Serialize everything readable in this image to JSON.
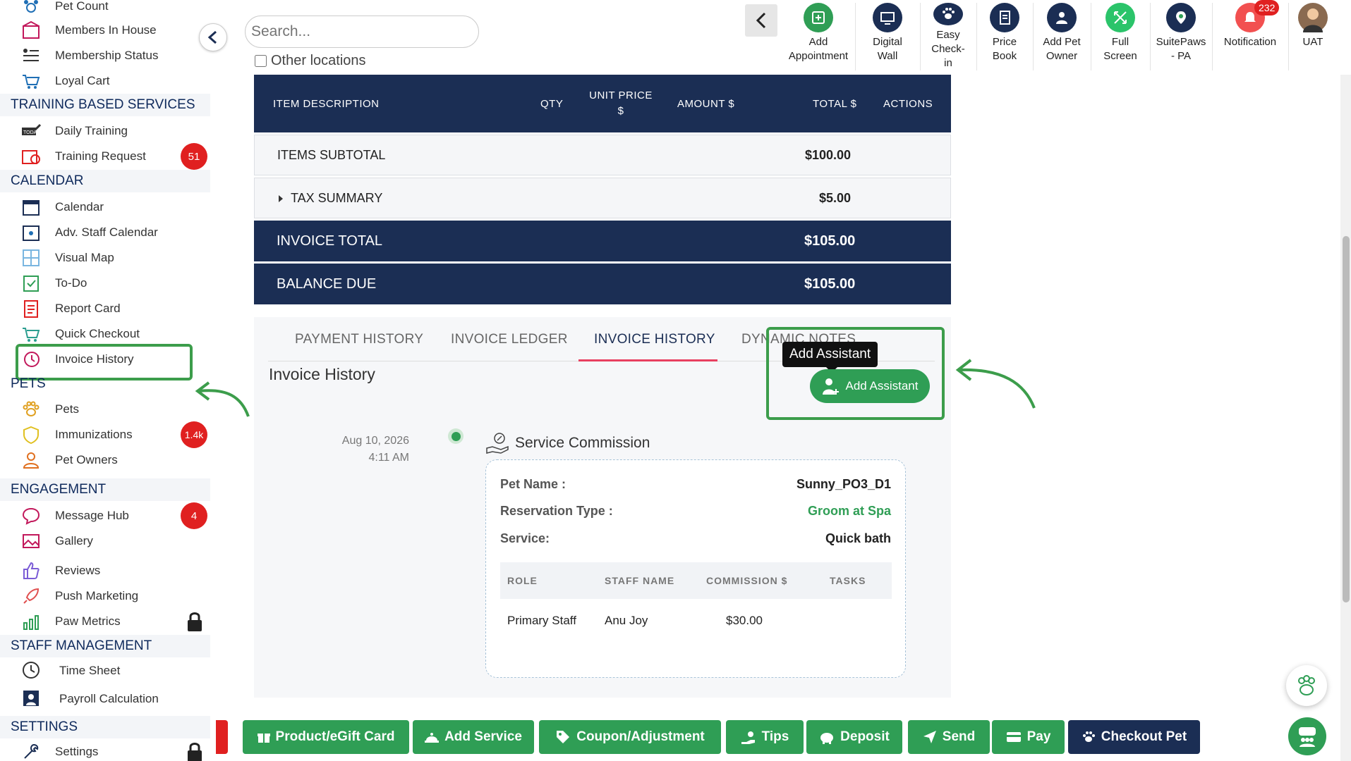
{
  "sidebar": {
    "items_top": [
      {
        "label": "Pet Count",
        "icon": "paw-count-icon"
      },
      {
        "label": "Members In House",
        "icon": "house-icon"
      },
      {
        "label": "Membership Status",
        "icon": "list-icon"
      },
      {
        "label": "Loyal Cart",
        "icon": "loyal-cart-icon"
      }
    ],
    "training_heading": "TRAINING BASED SERVICES",
    "training": [
      {
        "label": "Daily Training",
        "icon": "today-icon"
      },
      {
        "label": "Training Request",
        "icon": "training-request-icon",
        "badge": "51"
      }
    ],
    "calendar_heading": "CALENDAR",
    "calendar": [
      {
        "label": "Calendar",
        "icon": "calendar-icon"
      },
      {
        "label": "Adv. Staff Calendar",
        "icon": "staff-calendar-icon"
      },
      {
        "label": "Visual Map",
        "icon": "visual-map-icon"
      },
      {
        "label": "To-Do",
        "icon": "todo-icon"
      },
      {
        "label": "Report Card",
        "icon": "report-card-icon"
      },
      {
        "label": "Quick Checkout",
        "icon": "cart-icon"
      },
      {
        "label": "Invoice History",
        "icon": "history-icon"
      }
    ],
    "pets_heading": "PETS",
    "pets": [
      {
        "label": "Pets",
        "icon": "paw-icon"
      },
      {
        "label": "Immunizations",
        "icon": "shield-icon",
        "badge": "1.4k"
      },
      {
        "label": "Pet Owners",
        "icon": "user-icon"
      }
    ],
    "engagement_heading": "ENGAGEMENT",
    "engagement": [
      {
        "label": "Message Hub",
        "icon": "chat-icon",
        "badge": "4"
      },
      {
        "label": "Gallery",
        "icon": "gallery-icon"
      },
      {
        "label": "Reviews",
        "icon": "thumbs-up-icon"
      },
      {
        "label": "Push Marketing",
        "icon": "rocket-icon"
      },
      {
        "label": "Paw Metrics",
        "icon": "chart-icon",
        "locked": true
      }
    ],
    "staff_heading": "STAFF MANAGEMENT",
    "staff": [
      {
        "label": "Time Sheet",
        "icon": "clock-icon"
      },
      {
        "label": "Payroll Calculation",
        "icon": "payroll-icon"
      }
    ],
    "settings_heading": "SETTINGS",
    "settings": [
      {
        "label": "Settings",
        "icon": "settings-icon",
        "locked": true
      }
    ]
  },
  "search": {
    "placeholder": "Search...",
    "other_locations": "Other locations"
  },
  "toolbar": [
    {
      "label": "Add\nAppointment",
      "icon": "add-appointment-icon",
      "color": "#2f9e55"
    },
    {
      "label": "Digital\nWall",
      "icon": "digital-wall-icon",
      "color": "#1b2e54"
    },
    {
      "label": "Easy\nCheck-\nin",
      "icon": "paw-checkin-icon",
      "color": "#1b2e54"
    },
    {
      "label": "Price\nBook",
      "icon": "price-book-icon",
      "color": "#1b2e54"
    },
    {
      "label": "Add Pet\nOwner",
      "icon": "add-owner-icon",
      "color": "#1b2e54"
    },
    {
      "label": "Full\nScreen",
      "icon": "fullscreen-icon",
      "color": "#2bc46a"
    },
    {
      "label": "SuitePaws\n- PA",
      "icon": "suitepaws-icon",
      "color": "#1b2e54"
    },
    {
      "label": "Notification",
      "icon": "bell-icon",
      "color": "#e02020",
      "badge": "232"
    },
    {
      "label": "UAT",
      "icon": "avatar"
    }
  ],
  "invoice": {
    "headers": [
      "ITEM DESCRIPTION",
      "QTY",
      "UNIT PRICE $",
      "AMOUNT $",
      "TOTAL $",
      "ACTIONS"
    ],
    "items_subtotal_label": "ITEMS SUBTOTAL",
    "items_subtotal": "$100.00",
    "tax_label": "TAX SUMMARY",
    "tax": "$5.00",
    "total_label": "INVOICE TOTAL",
    "total": "$105.00",
    "balance_label": "BALANCE DUE",
    "balance": "$105.00"
  },
  "tabs": [
    "PAYMENT HISTORY",
    "INVOICE LEDGER",
    "INVOICE HISTORY",
    "DYNAMIC NOTES"
  ],
  "invoice_history": {
    "title": "Invoice History",
    "tooltip": "Add Assistant",
    "add_assistant": "Add Assistant",
    "date": "Aug 10, 2026",
    "time": "4:11 AM",
    "event_title": "Service Commission",
    "pet_name_label": "Pet Name :",
    "pet_name": "Sunny_PO3_D1",
    "reservation_label": "Reservation Type :",
    "reservation": "Groom at Spa",
    "service_label": "Service:",
    "service": "Quick bath",
    "commission_headers": [
      "ROLE",
      "STAFF NAME",
      "COMMISSION $",
      "TASKS"
    ],
    "commission_row": [
      "Primary Staff",
      "Anu Joy",
      "$30.00",
      ""
    ]
  },
  "bottom_bar": [
    {
      "label": "Product/eGift Card",
      "icon": "gift-icon"
    },
    {
      "label": "Add Service",
      "icon": "service-icon"
    },
    {
      "label": "Coupon/Adjustment",
      "icon": "tag-icon"
    },
    {
      "label": "Tips",
      "icon": "tips-icon"
    },
    {
      "label": "Deposit",
      "icon": "piggy-icon"
    },
    {
      "label": "Send",
      "icon": "send-icon"
    },
    {
      "label": "Pay",
      "icon": "card-icon"
    },
    {
      "label": "Checkout Pet",
      "icon": "paw-icon"
    }
  ],
  "colors": {
    "navy": "#1b2e54",
    "green": "#2f9e55",
    "red": "#e02020",
    "highlight": "#3c9d4b"
  }
}
